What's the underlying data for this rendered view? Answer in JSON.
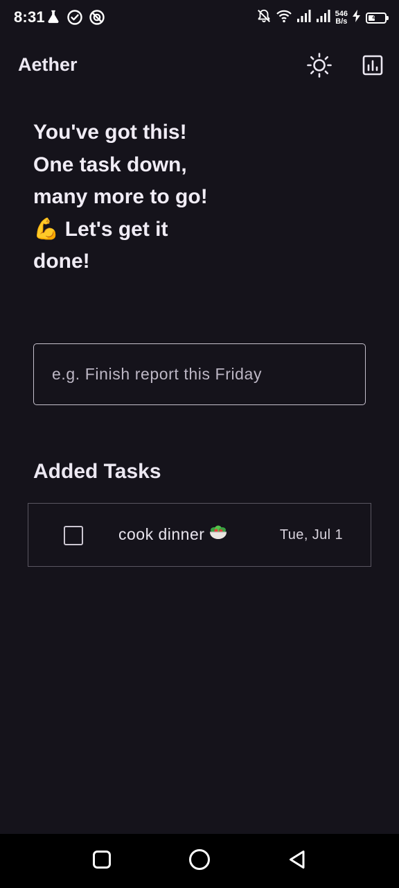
{
  "status_bar": {
    "time": "8:31",
    "left_icons": [
      "flask-icon",
      "check-circle-icon",
      "no-entry-icon"
    ],
    "right_icons": [
      "bell-off-icon",
      "wifi-icon",
      "signal-icon",
      "signal-icon",
      "charging-icon"
    ],
    "net_speed_value": "546",
    "net_speed_unit": "B/s",
    "battery_level": "41",
    "battery_fraction": 0.41
  },
  "app_bar": {
    "title": "Aether",
    "actions": [
      "sun-icon",
      "chart-icon"
    ]
  },
  "motivation": {
    "lines": [
      "You've got this!",
      "One task down,",
      "many more to go!",
      "💪  Let's get it",
      "done!"
    ]
  },
  "task_input": {
    "value": "",
    "placeholder": "e.g. Finish report this Friday"
  },
  "tasks_section": {
    "title": "Added Tasks",
    "items": [
      {
        "name": "cook dinner",
        "emoji_icon": "salad-bowl-icon",
        "date": "Tue, Jul 1",
        "checked": false
      }
    ]
  },
  "nav_bar": {
    "buttons": [
      "recent-apps-icon",
      "home-icon",
      "back-icon"
    ]
  },
  "colors": {
    "background": "#15131b",
    "text": "#f0ecf5",
    "outline": "#c6c1cd",
    "card_border": "#5a5661",
    "nav_background": "#000000"
  }
}
